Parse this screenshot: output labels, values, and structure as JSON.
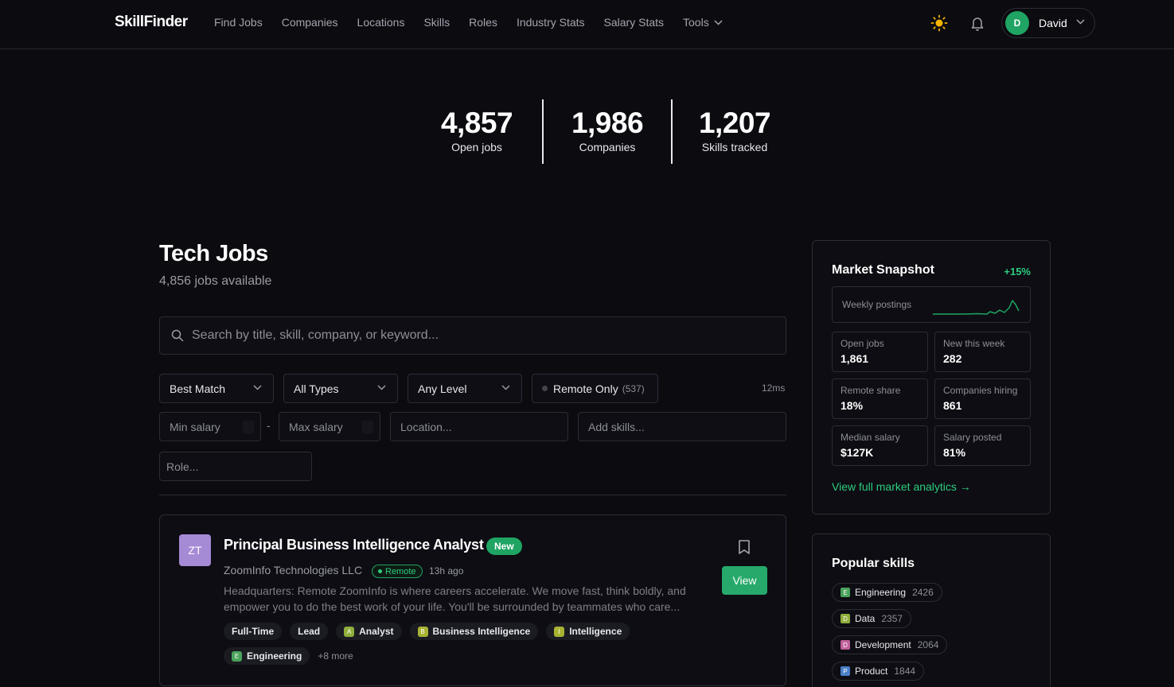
{
  "nav": {
    "brand": "SkillFinder",
    "links": [
      "Find Jobs",
      "Companies",
      "Locations",
      "Skills",
      "Roles",
      "Industry Stats",
      "Salary Stats"
    ],
    "tools_label": "Tools",
    "user": {
      "initial": "D",
      "name": "David"
    }
  },
  "hero": {
    "stats": [
      {
        "value": "4,857",
        "label": "Open jobs"
      },
      {
        "value": "1,986",
        "label": "Companies"
      },
      {
        "value": "1,207",
        "label": "Skills tracked"
      }
    ]
  },
  "main": {
    "title": "Tech Jobs",
    "subtitle": "4,856 jobs available",
    "search_placeholder": "Search by title, skill, company, or keyword...",
    "filters": {
      "sort": "Best Match",
      "type": "All Types",
      "level": "Any Level",
      "remote_label": "Remote Only",
      "remote_count": "(537)",
      "timing": "12ms",
      "min_salary_placeholder": "Min salary",
      "dash": "-",
      "max_salary_placeholder": "Max salary",
      "location_placeholder": "Location...",
      "skills_placeholder": "Add skills...",
      "role_placeholder": "Role..."
    },
    "job": {
      "logo": "ZT",
      "logo_color": "#a58ad6",
      "title": "Principal Business Intelligence Analyst",
      "badge": "New",
      "company": "ZoomInfo Technologies LLC",
      "remote_badge": "Remote",
      "ago": "13h ago",
      "description": "Headquarters: Remote ZoomInfo is where careers accelerate. We move fast, think boldly, and empower you to do the best work of your life. You'll be surrounded by teammates who care...",
      "view_label": "View",
      "tags": [
        {
          "label": "Full-Time"
        },
        {
          "label": "Lead"
        },
        {
          "label": "Analyst",
          "letter": "A",
          "color": "#8fae3b"
        },
        {
          "label": "Business Intelligence",
          "letter": "B",
          "color": "#a8b332"
        },
        {
          "label": "Intelligence",
          "letter": "I",
          "color": "#a8b332"
        },
        {
          "label": "Engineering",
          "letter": "E",
          "color": "#4aa35a"
        }
      ],
      "more": "+8 more"
    }
  },
  "snapshot": {
    "title": "Market Snapshot",
    "delta": "+15%",
    "spark_label": "Weekly postings",
    "metrics": [
      {
        "label": "Open jobs",
        "value": "1,861"
      },
      {
        "label": "New this week",
        "value": "282"
      },
      {
        "label": "Remote share",
        "value": "18%"
      },
      {
        "label": "Companies hiring",
        "value": "861"
      },
      {
        "label": "Median salary",
        "value": "$127K"
      },
      {
        "label": "Salary posted",
        "value": "81%"
      }
    ],
    "link": "View full market analytics →"
  },
  "skills": {
    "title": "Popular skills",
    "items": [
      {
        "letter": "E",
        "label": "Engineering",
        "count": "2426",
        "color": "#4aa35a"
      },
      {
        "letter": "D",
        "label": "Data",
        "count": "2357",
        "color": "#8fae3b"
      },
      {
        "letter": "D",
        "label": "Development",
        "count": "2064",
        "color": "#c05f9c"
      },
      {
        "letter": "P",
        "label": "Product",
        "count": "1844",
        "color": "#4a7fc9"
      }
    ]
  },
  "colors": {
    "accent": "#1fa463",
    "link": "#2ecc7e",
    "background": "#0b0b10"
  }
}
